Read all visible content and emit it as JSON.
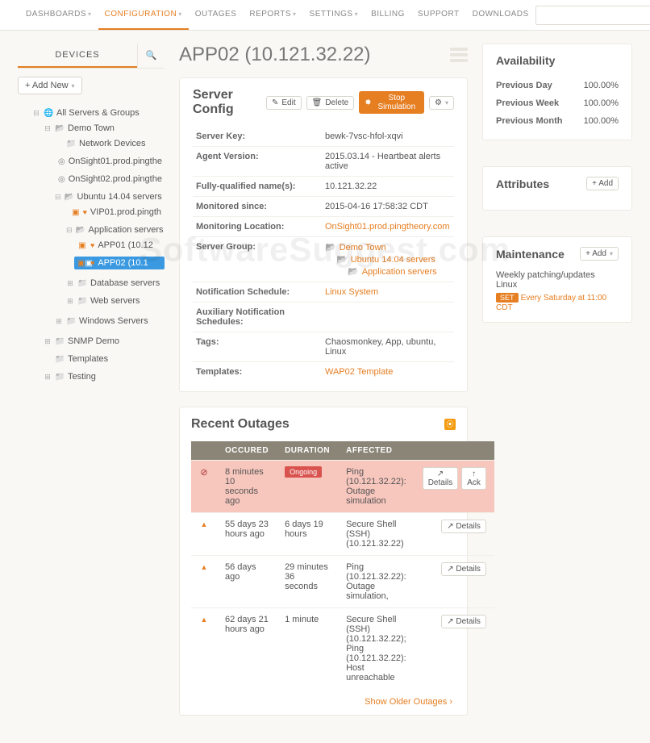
{
  "nav": [
    "DASHBOARDS",
    "CONFIGURATION",
    "OUTAGES",
    "REPORTS",
    "SETTINGS",
    "BILLING",
    "SUPPORT",
    "DOWNLOADS"
  ],
  "nav_active": 1,
  "nav_has_chev": [
    true,
    true,
    false,
    true,
    true,
    false,
    false,
    false
  ],
  "alerts": {
    "gear_count": "1",
    "warn_count": "1"
  },
  "sidebar": {
    "tab": "DEVICES",
    "add_new": "+ Add New",
    "root": "All Servers & Groups",
    "tree": {
      "demo_town": "Demo Town",
      "network_devices": "Network Devices",
      "onsight01": "OnSight01.prod.pingthe",
      "onsight02": "OnSight02.prod.pingthe",
      "ubuntu": "Ubuntu 14.04 servers",
      "vip01": "VIP01.prod.pingth",
      "app_servers": "Application servers",
      "app01": "APP01 (10.12",
      "app02": "APP02 (10.1",
      "db_servers": "Database servers",
      "web_servers": "Web servers",
      "win_servers": "Windows Servers",
      "snmp": "SNMP Demo",
      "templates": "Templates",
      "testing": "Testing"
    }
  },
  "page_title": "APP02 (10.121.32.22)",
  "config": {
    "title": "Server Config",
    "buttons": {
      "edit": "Edit",
      "delete": "Delete",
      "stop": "Stop Simulation"
    },
    "rows": {
      "server_key_l": "Server Key:",
      "server_key_v": "bewk-7vsc-hfol-xqvi",
      "agent_l": "Agent Version:",
      "agent_v": "2015.03.14 - Heartbeat alerts active",
      "fqdn_l": "Fully-qualified name(s):",
      "fqdn_v": "10.121.32.22",
      "since_l": "Monitored since:",
      "since_v": "2015-04-16 17:58:32 CDT",
      "loc_l": "Monitoring Location:",
      "loc_v": "OnSight01.prod.pingtheory.com",
      "group_l": "Server Group:",
      "group_crumb": [
        "Demo Town",
        "Ubuntu 14.04 servers",
        "Application servers"
      ],
      "notif_l": "Notification Schedule:",
      "notif_v": "Linux System",
      "aux_l": "Auxiliary Notification Schedules:",
      "aux_v": "",
      "tags_l": "Tags:",
      "tags_v": "Chaosmonkey, App, ubuntu, Linux",
      "tmpl_l": "Templates:",
      "tmpl_v": "WAP02 Template"
    }
  },
  "availability": {
    "title": "Availability",
    "rows": [
      {
        "k": "Previous Day",
        "v": "100.00%"
      },
      {
        "k": "Previous Week",
        "v": "100.00%"
      },
      {
        "k": "Previous Month",
        "v": "100.00%"
      }
    ]
  },
  "attributes": {
    "title": "Attributes",
    "add": "+ Add"
  },
  "maintenance": {
    "title": "Maintenance",
    "add": "+ Add",
    "desc": "Weekly patching/updates Linux",
    "badge": "SET",
    "sched": "Every Saturday at 11:00 CDT"
  },
  "outages": {
    "title": "Recent Outages",
    "cols": [
      "OCCURED",
      "DURATION",
      "AFFECTED"
    ],
    "rows": [
      {
        "status": "err",
        "occured": "8 minutes 10 seconds ago",
        "duration_pill": "Ongoing",
        "duration": "",
        "affected": "Ping (10.121.32.22): Outage simulation",
        "details": true,
        "ack": true
      },
      {
        "status": "warn",
        "occured": "55 days 23 hours ago",
        "duration": "6 days 19 hours",
        "affected": "Secure Shell (SSH) (10.121.32.22)",
        "details": true
      },
      {
        "status": "warn",
        "occured": "56 days ago",
        "duration": "29 minutes 36 seconds",
        "affected": "Ping (10.121.32.22): Outage simulation,",
        "details": true
      },
      {
        "status": "warn",
        "occured": "62 days 21 hours ago",
        "duration": "1 minute",
        "affected": "Secure Shell (SSH) (10.121.32.22);\nPing (10.121.32.22): Host unreachable",
        "details": true
      }
    ],
    "details_label": "Details",
    "ack_label": "Ack",
    "older": "Show Older Outages"
  },
  "watermark": "SoftwareSuggest.com"
}
